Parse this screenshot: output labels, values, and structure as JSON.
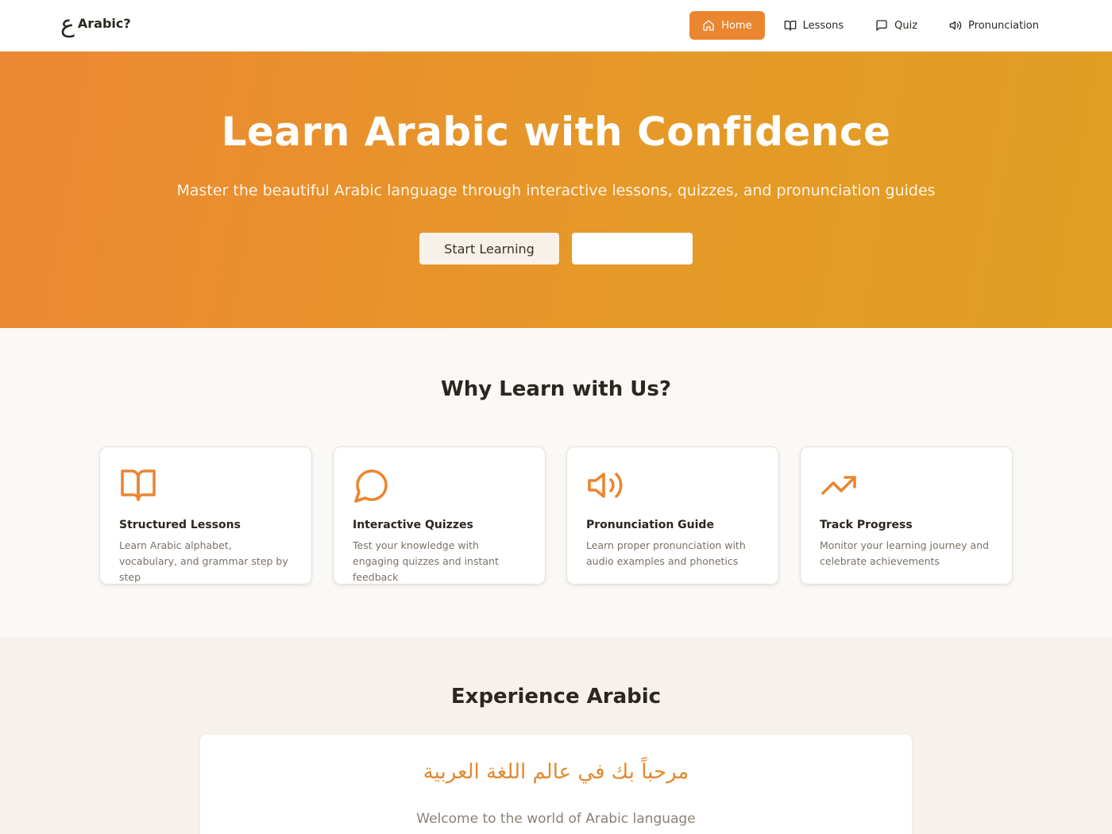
{
  "nav": {
    "brand_glyph": "ع",
    "brand_name": "Arabic?",
    "items": [
      {
        "label": "Home",
        "icon": "home-icon",
        "active": true
      },
      {
        "label": "Lessons",
        "icon": "book-icon",
        "active": false
      },
      {
        "label": "Quiz",
        "icon": "message-icon",
        "active": false
      },
      {
        "label": "Pronunciation",
        "icon": "speaker-icon",
        "active": false
      }
    ]
  },
  "hero": {
    "title": "Learn Arabic with Confidence",
    "subtitle": "Master the beautiful Arabic language through interactive lessons, quizzes, and pronunciation guides",
    "primary_button": "Start Learning",
    "secondary_button": ""
  },
  "features": {
    "title": "Why Learn with Us?",
    "cards": [
      {
        "icon": "book-open-icon",
        "title": "Structured Lessons",
        "description": "Learn Arabic alphabet, vocabulary, and grammar step by step"
      },
      {
        "icon": "chat-bubble-icon",
        "title": "Interactive Quizzes",
        "description": "Test your knowledge with engaging quizzes and instant feedback"
      },
      {
        "icon": "volume-icon",
        "title": "Pronunciation Guide",
        "description": "Learn proper pronunciation with audio examples and phonetics"
      },
      {
        "icon": "trending-up-icon",
        "title": "Track Progress",
        "description": "Monitor your learning journey and celebrate achievements"
      }
    ]
  },
  "experience": {
    "title": "Experience Arabic",
    "arabic_text": "مرحباً بك في عالم اللغة العربية",
    "translation": "Welcome to the world of Arabic language"
  },
  "colors": {
    "accent": "#ea8630",
    "hero_gradient_start": "#ec8733",
    "hero_gradient_end": "#e09e22"
  }
}
